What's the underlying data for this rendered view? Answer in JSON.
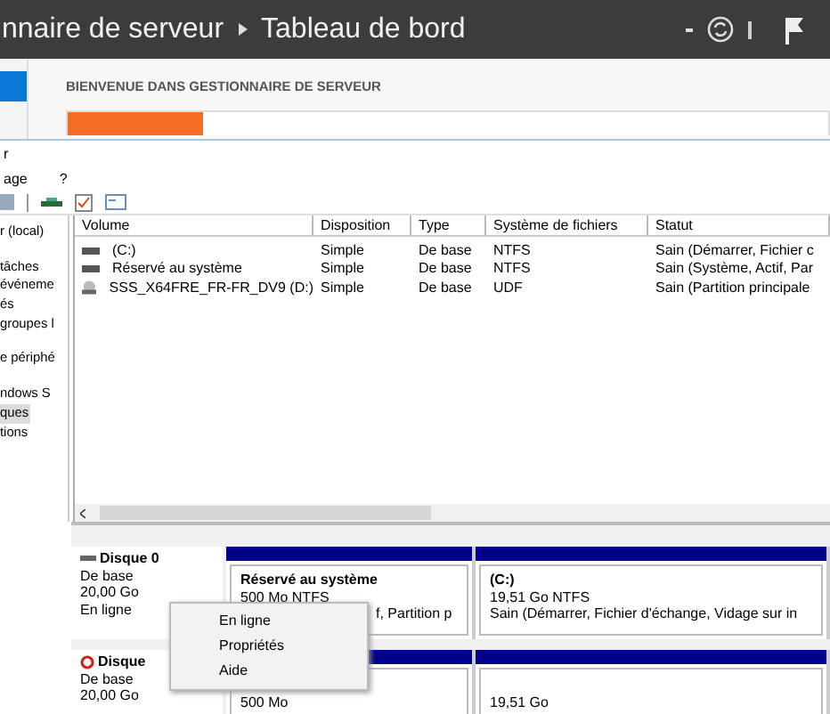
{
  "top_bar": {
    "breadcrumb": [
      "nnaire de serveur",
      "Tableau de bord"
    ]
  },
  "dashboard": {
    "welcome": "BIENVENUE DANS GESTIONNAIRE DE SERVEUR"
  },
  "disk_window": {
    "title": "r",
    "menu": [
      "age",
      "?"
    ],
    "tree": [
      {
        "label": "r (local)",
        "selected": false
      },
      {
        "label": "tâches",
        "selected": false
      },
      {
        "label": "événeme",
        "selected": false
      },
      {
        "label": "és",
        "selected": false
      },
      {
        "label": "groupes l",
        "selected": false
      },
      {
        "label": "e périphé",
        "selected": false
      },
      {
        "label": "ndows S",
        "selected": false
      },
      {
        "label": "ques",
        "selected": true
      },
      {
        "label": "tions",
        "selected": false
      }
    ],
    "table": {
      "columns": [
        "Volume",
        "Disposition",
        "Type",
        "Système de fichiers",
        "Statut"
      ],
      "rows": [
        {
          "kind": "drive",
          "cells": [
            "(C:)",
            "Simple",
            "De base",
            "NTFS",
            "Sain (Démarrer, Fichier c"
          ]
        },
        {
          "kind": "drive",
          "cells": [
            "Réservé au système",
            "Simple",
            "De base",
            "NTFS",
            "Sain (Système, Actif, Par"
          ]
        },
        {
          "kind": "disc",
          "cells": [
            "SSS_X64FRE_FR-FR_DV9 (D:)",
            "Simple",
            "De base",
            "UDF",
            "Sain (Partition principale"
          ]
        }
      ]
    },
    "disks": [
      {
        "kind": "basic",
        "name": "Disque 0",
        "lines": [
          "De base",
          "20,00 Go",
          "En ligne"
        ],
        "partitions": [
          {
            "lines": [
              "Réservé au système",
              "500 Mo NTFS",
              "f, Partition p"
            ]
          },
          {
            "lines": [
              "(C:)",
              "19,51 Go NTFS",
              "Sain (Démarrer, Fichier d'échange, Vidage sur in"
            ]
          }
        ]
      },
      {
        "kind": "offline",
        "name": "Disque",
        "lines": [
          "De base",
          "20,00 Go"
        ],
        "partitions": [
          {
            "lines": [
              "500 Mo"
            ]
          },
          {
            "lines": [
              "19,51 Go"
            ]
          }
        ]
      }
    ],
    "context_menu": [
      "En ligne",
      "Propriétés",
      "Aide"
    ]
  }
}
